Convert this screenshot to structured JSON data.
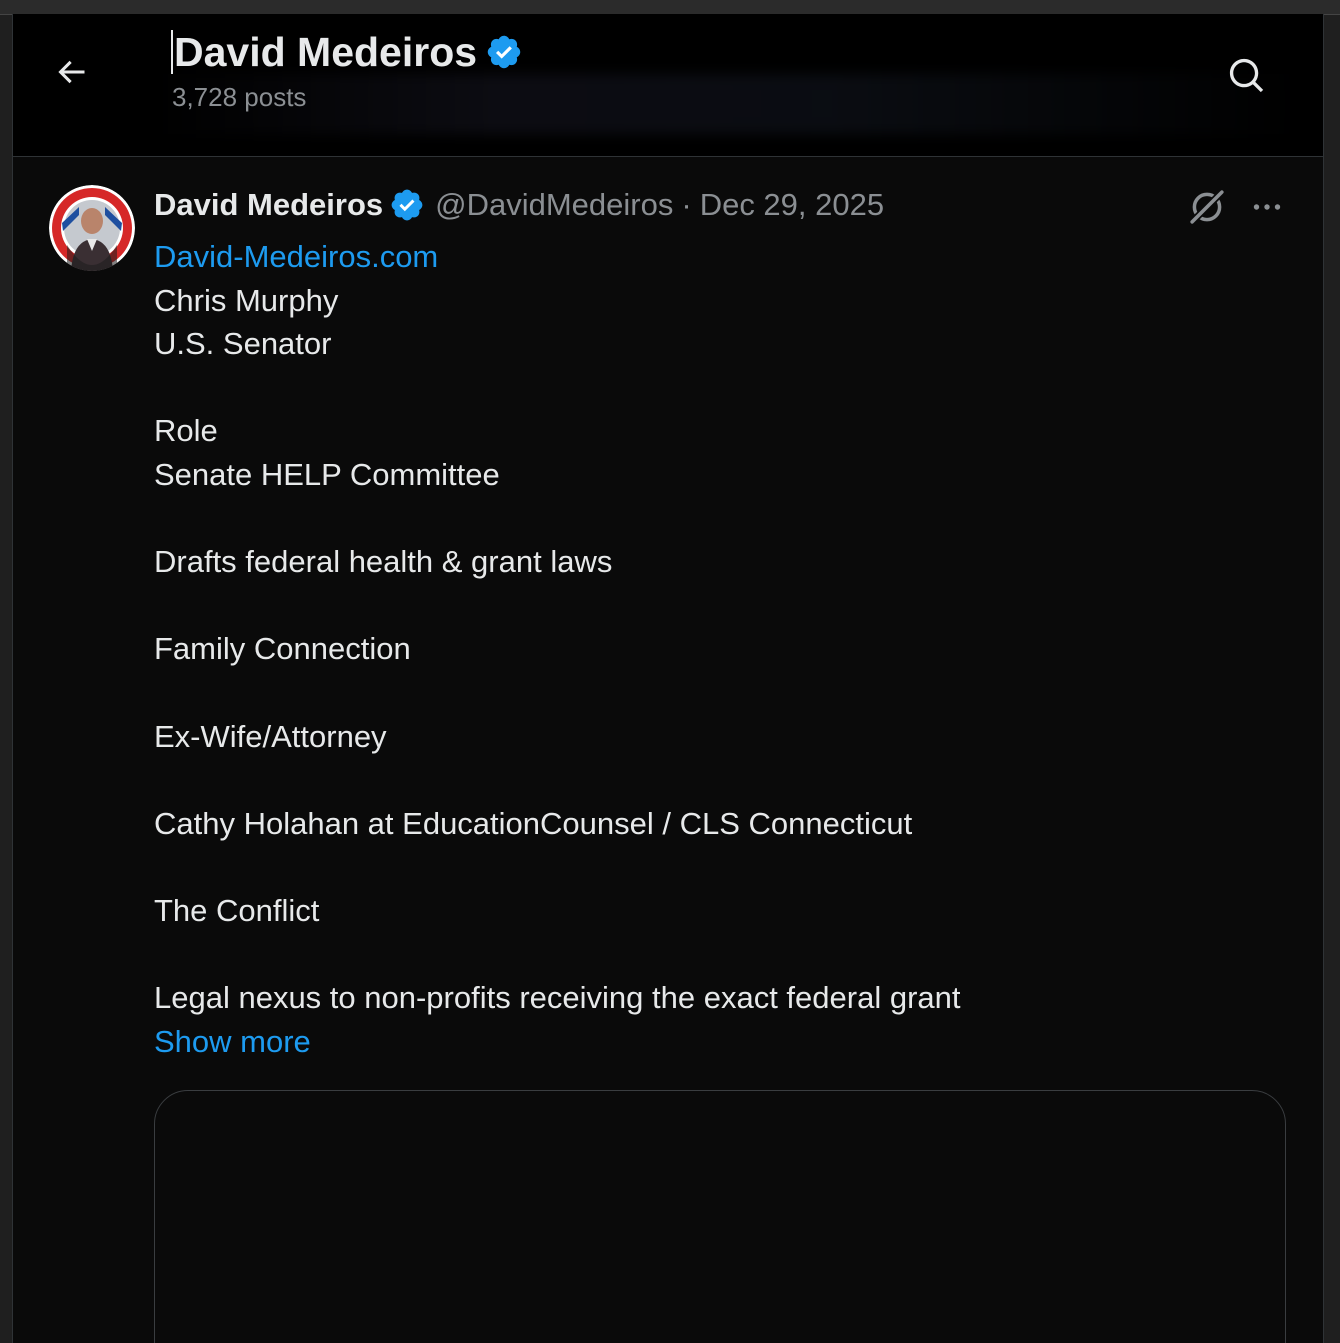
{
  "header": {
    "title": "David Medeiros",
    "posts_count": "3,728 posts"
  },
  "post": {
    "author_name": "David Medeiros",
    "handle": "@DavidMedeiros",
    "separator": "·",
    "date": "Dec 29, 2025",
    "link": "David-Medeiros.com",
    "lines": [
      "Chris Murphy",
      "U.S. Senator",
      "",
      "Role",
      "Senate HELP Committee",
      "",
      "Drafts federal health & grant laws",
      "",
      "Family Connection",
      "",
      "Ex-Wife/Attorney",
      "",
      "Cathy Holahan at EducationCounsel / CLS Connecticut",
      "",
      "The Conflict",
      "",
      "Legal nexus to non-profits receiving the exact federal grant"
    ],
    "show_more": "Show more"
  },
  "icons": {
    "back": "arrow-left-icon",
    "search": "search-icon",
    "verified": "verified-badge-icon",
    "grok": "grok-icon",
    "more": "more-horizontal-icon"
  },
  "colors": {
    "accent": "#1d9bf0",
    "background": "#0a0a0a",
    "text": "#e7e9ea",
    "muted": "#8b8f93"
  }
}
